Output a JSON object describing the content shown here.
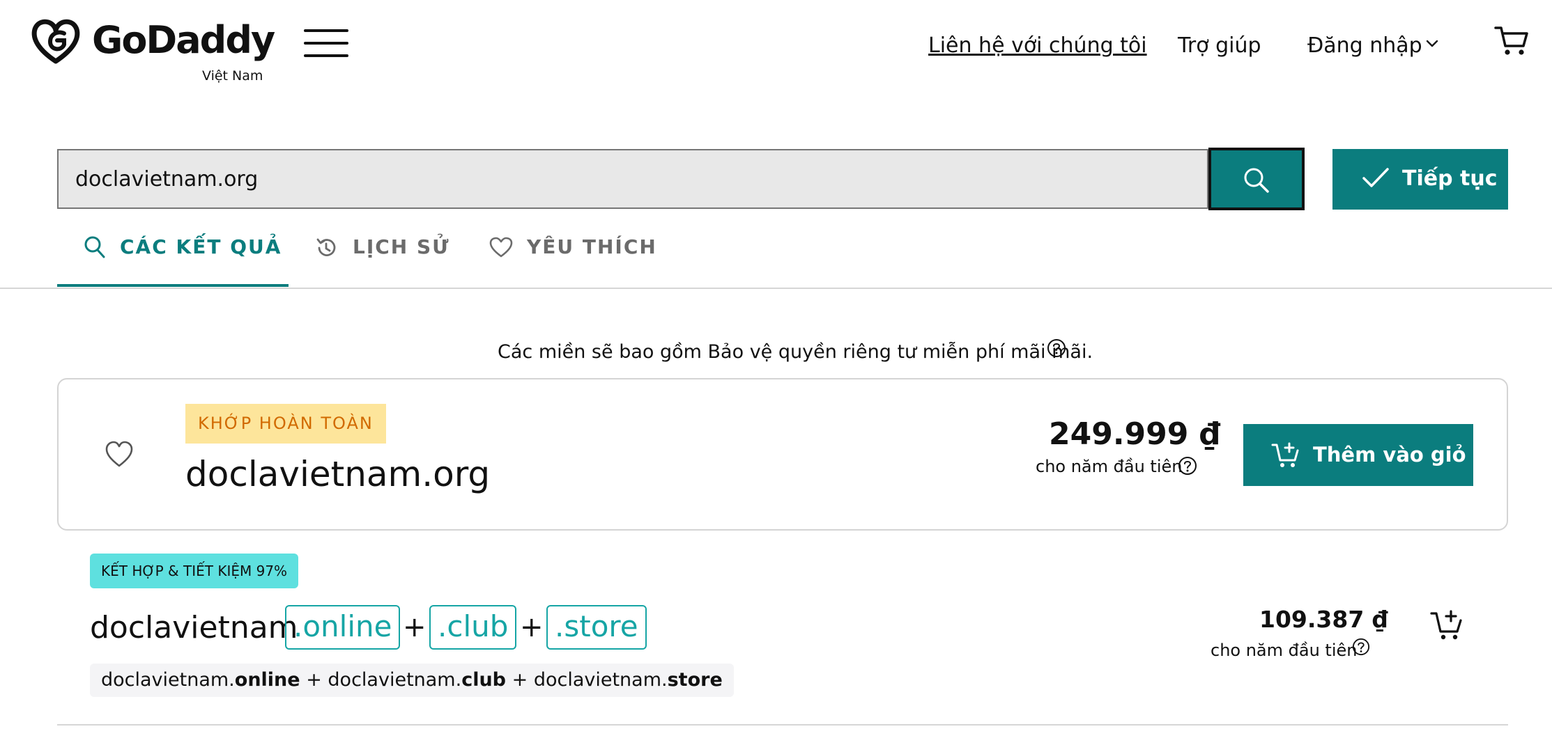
{
  "brand": {
    "name": "GoDaddy",
    "region": "Việt Nam",
    "accent_color": "#0b7d7e"
  },
  "nav": {
    "contact": "Liên hệ với chúng tôi",
    "help": "Trợ giúp",
    "login": "Đăng nhập"
  },
  "search": {
    "value": "doclavietnam.org",
    "continue_label": "Tiếp tục"
  },
  "tabs": [
    {
      "label": "CÁC KẾT QUẢ",
      "icon": "search-icon",
      "active": true
    },
    {
      "label": "LỊCH SỬ",
      "icon": "history-icon",
      "active": false
    },
    {
      "label": "YÊU THÍCH",
      "icon": "heart-icon",
      "active": false
    }
  ],
  "privacy_note": "Các miền sẽ bao gồm Bảo vệ quyền riêng tư miễn phí mãi mãi.",
  "exact_match": {
    "badge": "KHỚP HOÀN TOÀN",
    "domain": "doclavietnam.org",
    "price": "249.999 ₫",
    "price_note": "cho năm đầu tiên",
    "add_to_cart": "Thêm vào giỏ"
  },
  "bundle": {
    "badge": "KẾT HỢP & TIẾT KIỆM 97%",
    "base": "doclavietnam",
    "tlds": [
      ".online",
      ".club",
      ".store"
    ],
    "plus": "+",
    "list": [
      {
        "base": "doclavietnam.",
        "tld": "online"
      },
      {
        "base": "doclavietnam.",
        "tld": "club"
      },
      {
        "base": "doclavietnam.",
        "tld": "store"
      }
    ],
    "price": "109.387 ₫",
    "price_note": "cho năm đầu tiên"
  }
}
